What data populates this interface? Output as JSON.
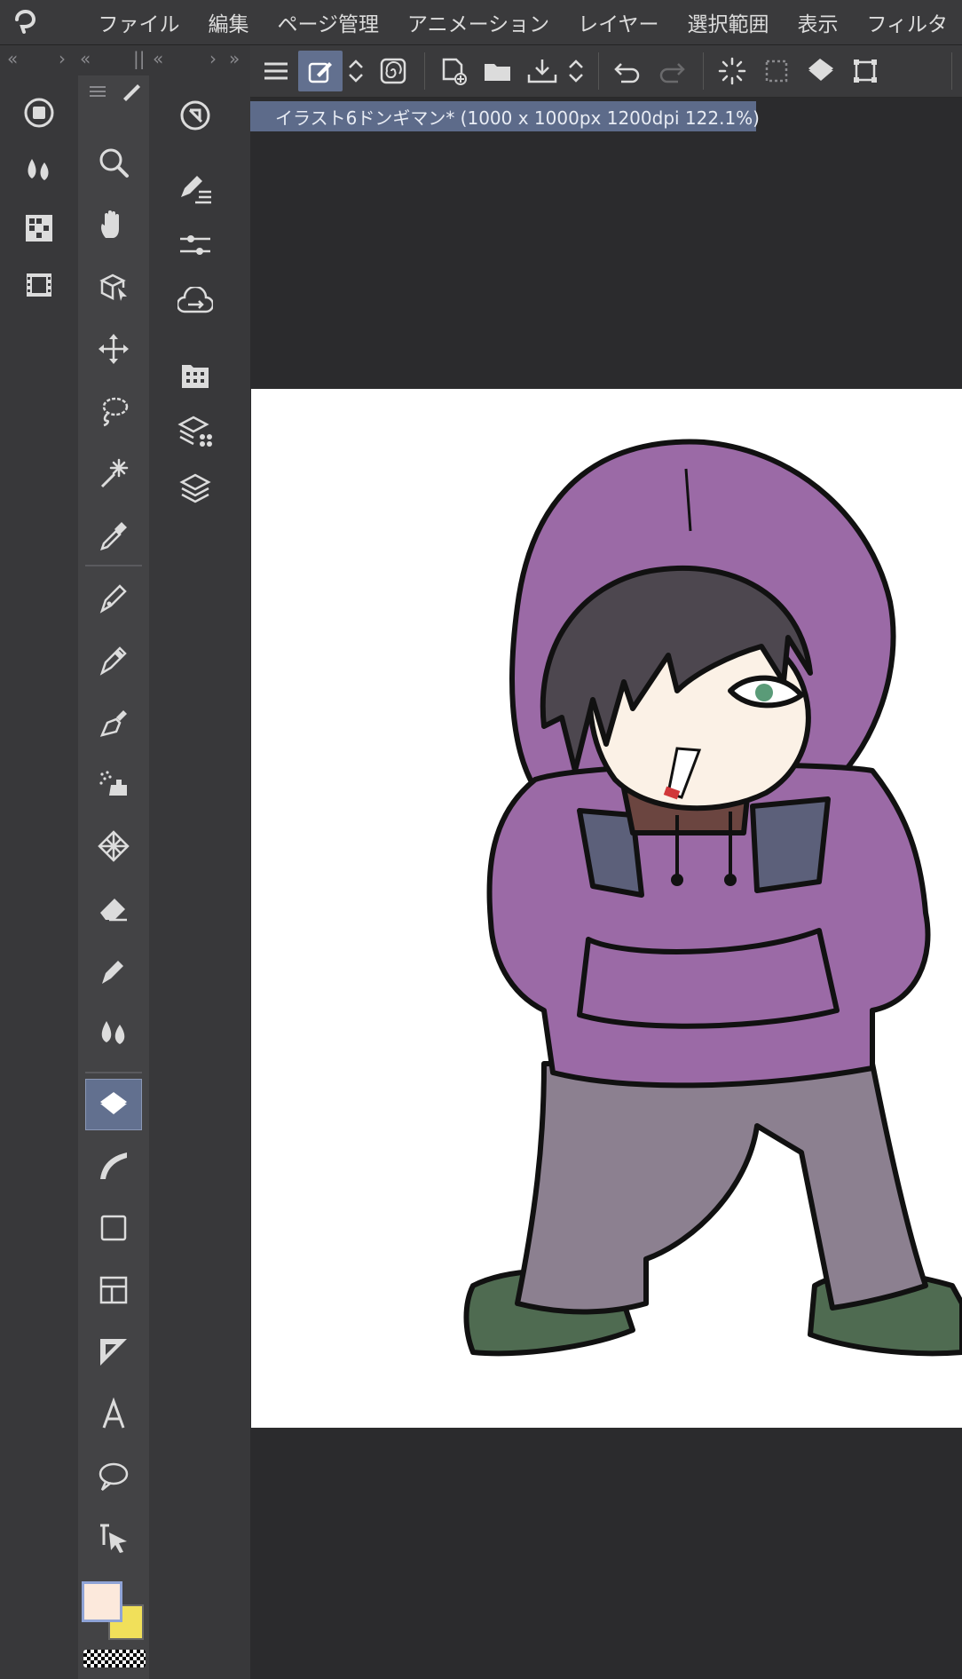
{
  "menu": {
    "items": [
      "ファイル",
      "編集",
      "ページ管理",
      "アニメーション",
      "レイヤー",
      "選択範囲",
      "表示",
      "フィルタ"
    ]
  },
  "panel_tabs": {
    "left_collapse": "«",
    "left_expand": "›",
    "mid_collapse": "«",
    "grip": "||",
    "right_collapse": "«",
    "right_expand": "›",
    "far_expand": "»"
  },
  "document": {
    "tab_title": "イラスト6ドンギマン* (1000 x 1000px 1200dpi 122.1%)"
  },
  "colors": {
    "main_color": "#fce9dc",
    "sub_color": "#f1e05a",
    "accent_active": "#62708f",
    "canvas_bg": "#ffffff",
    "hoodie": "#9b6aa6",
    "pants": "#8c8090",
    "shoes": "#4f6b51",
    "hair": "#4d474f",
    "skin": "#fbf1e6"
  },
  "command_bar": {
    "icons": [
      "menu-icon",
      "edit-pen-icon",
      "up-down-icon",
      "swirl-icon",
      "new-file-icon",
      "open-file-icon",
      "save-icon",
      "up-down-icon",
      "undo-icon",
      "redo-icon",
      "clear-icon",
      "deselect-icon",
      "fill-icon",
      "transform-icon"
    ]
  },
  "tool_column": {
    "icons": [
      "zoom-icon",
      "hand-icon",
      "object-select-icon",
      "move-icon",
      "lasso-icon",
      "magic-wand-icon",
      "eyedropper-icon",
      "pen-icon",
      "pencil-icon",
      "brush-icon",
      "airbrush-icon",
      "decoration-icon",
      "eraser-icon",
      "blend-icon",
      "fill-icon",
      "gradient-icon",
      "figure-icon",
      "frame-icon",
      "ruler-icon",
      "text-icon",
      "balloon-icon",
      "correct-line-icon"
    ]
  },
  "palette_column": {
    "icons": [
      "sub-view-icon",
      "brush-size-icon",
      "material-icon",
      "timeline-icon"
    ]
  },
  "panel_column": {
    "icons": [
      "navigator-icon",
      "tool-property-icon",
      "tool-detail-icon",
      "sync-icon",
      "material-panel-icon",
      "layer-property-icon",
      "layer-icon"
    ]
  }
}
